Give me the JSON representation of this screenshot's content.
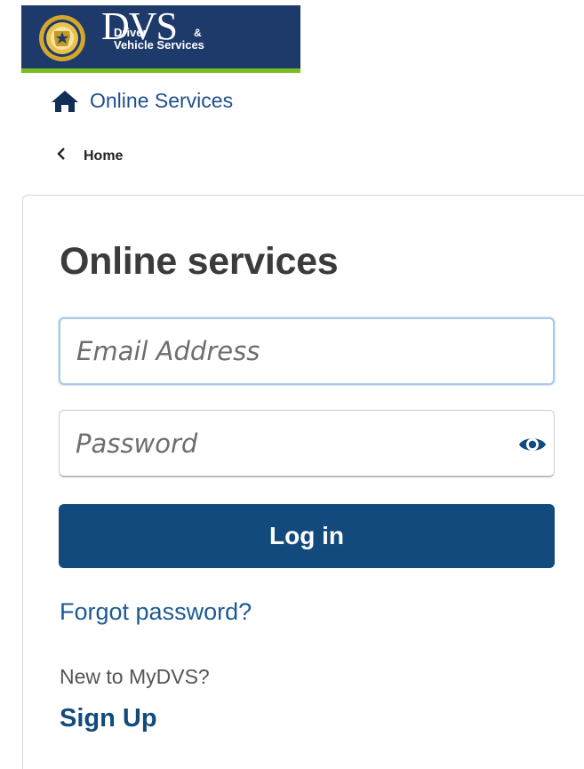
{
  "header": {
    "logo_main": "DVS",
    "logo_line1": "Driver",
    "logo_amp": "&",
    "logo_line2": "Vehicle Services"
  },
  "nav": {
    "online_services_label": "Online Services",
    "back_label": "Home"
  },
  "login_card": {
    "title": "Online services",
    "email_placeholder": "Email Address",
    "password_placeholder": "Password",
    "login_label": "Log in",
    "forgot_label": "Forgot password?",
    "new_user_text": "New to MyDVS?",
    "signup_label": "Sign Up"
  },
  "icons": {
    "home": "home-icon",
    "back": "chevron-left-icon",
    "show_password": "eye-icon"
  },
  "colors": {
    "banner": "#1d3a6b",
    "banner_accent": "#78be20",
    "primary": "#124a7e",
    "link": "#1d5a94"
  }
}
